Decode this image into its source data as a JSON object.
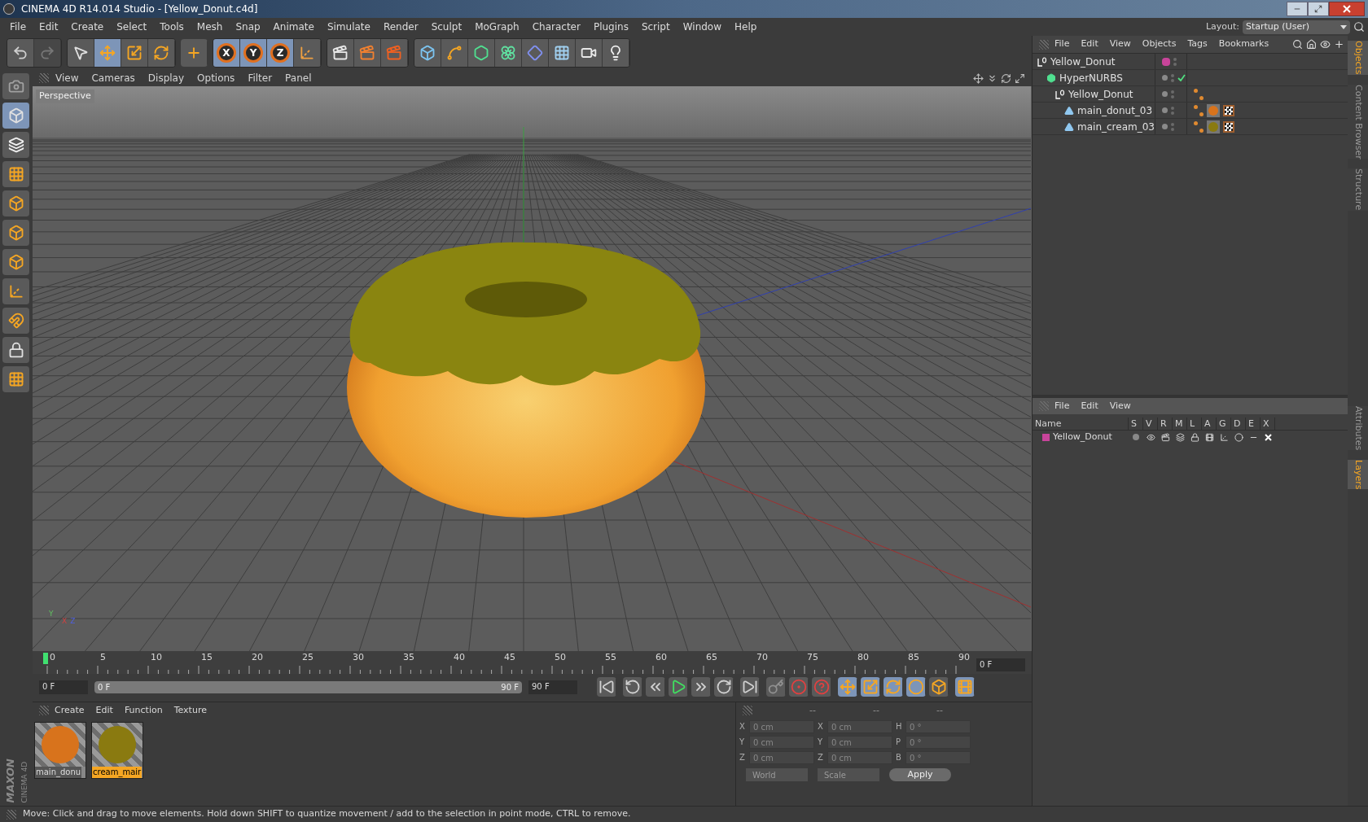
{
  "window": {
    "title": "CINEMA 4D R14.014 Studio - [Yellow_Donut.c4d]"
  },
  "menu_bar": [
    "File",
    "Edit",
    "Create",
    "Select",
    "Tools",
    "Mesh",
    "Snap",
    "Animate",
    "Simulate",
    "Render",
    "Sculpt",
    "MoGraph",
    "Character",
    "Plugins",
    "Script",
    "Window",
    "Help"
  ],
  "layout": {
    "label": "Layout:",
    "value": "Startup (User)"
  },
  "toolbar": [
    [
      {
        "kind": "undo",
        "selected": false,
        "disabled": false
      },
      {
        "kind": "redo",
        "selected": false,
        "disabled": true
      }
    ],
    [
      {
        "kind": "select",
        "selected": false,
        "disabled": false
      },
      {
        "kind": "move",
        "selected": true,
        "disabled": false
      },
      {
        "kind": "scale",
        "selected": false,
        "disabled": false
      },
      {
        "kind": "rotate",
        "selected": false,
        "disabled": false
      }
    ],
    [
      {
        "kind": "add",
        "selected": false,
        "disabled": false
      }
    ],
    [
      {
        "kind": "axis",
        "label": "X",
        "selected": true,
        "disabled": false
      },
      {
        "kind": "axis",
        "label": "Y",
        "selected": true,
        "disabled": false
      },
      {
        "kind": "axis",
        "label": "Z",
        "selected": true,
        "disabled": false
      },
      {
        "kind": "coords",
        "selected": false,
        "disabled": false
      }
    ],
    [
      {
        "kind": "render_view",
        "selected": false,
        "disabled": false
      },
      {
        "kind": "render_picture",
        "selected": false,
        "disabled": false
      },
      {
        "kind": "render_settings",
        "selected": false,
        "disabled": false
      }
    ],
    [
      {
        "kind": "cube",
        "selected": false,
        "disabled": false
      },
      {
        "kind": "spline",
        "selected": false,
        "disabled": false
      },
      {
        "kind": "nurbs",
        "selected": false,
        "disabled": false
      },
      {
        "kind": "array",
        "selected": false,
        "disabled": false
      },
      {
        "kind": "deformer",
        "selected": false,
        "disabled": false
      },
      {
        "kind": "floor",
        "selected": false,
        "disabled": false
      },
      {
        "kind": "camera",
        "selected": false,
        "disabled": false
      },
      {
        "kind": "light",
        "selected": false,
        "disabled": false
      }
    ]
  ],
  "left_tools": [
    {
      "kind": "view",
      "selected": false
    },
    {
      "kind": "model",
      "selected": true
    },
    {
      "kind": "texture",
      "selected": false
    },
    {
      "kind": "workplane",
      "selected": false
    },
    {
      "kind": "points",
      "selected": false
    },
    {
      "kind": "edges",
      "selected": false
    },
    {
      "kind": "polygons",
      "selected": false
    },
    {
      "kind": "axis",
      "selected": false
    },
    {
      "kind": "magnet",
      "selected": false
    },
    {
      "kind": "lock",
      "selected": false
    },
    {
      "kind": "grid",
      "selected": false
    }
  ],
  "brand": {
    "maker": "MAXON",
    "product": "CINEMA 4D"
  },
  "viewport": {
    "menu": [
      "View",
      "Cameras",
      "Display",
      "Options",
      "Filter",
      "Panel"
    ],
    "label": "Perspective",
    "axis_labels": [
      "Y",
      "X",
      "Z"
    ]
  },
  "objects_panel": {
    "menu": [
      "File",
      "Edit",
      "View",
      "Objects",
      "Tags",
      "Bookmarks"
    ],
    "tree": [
      {
        "name": "Yellow_Donut",
        "kind": "null",
        "color": "#c8449a",
        "check": false,
        "children": [
          {
            "name": "HyperNURBS",
            "kind": "nurbs",
            "check": true,
            "children": [
              {
                "name": "Yellow_Donut",
                "kind": "null",
                "check": false,
                "tags": [
                  {
                    "kind": "phong"
                  }
                ],
                "children": [
                  {
                    "name": "main_donut_03",
                    "kind": "polygon",
                    "check": false,
                    "tags": [
                      {
                        "kind": "phong"
                      },
                      {
                        "kind": "material",
                        "color": "#d8731c"
                      },
                      {
                        "kind": "texture"
                      }
                    ]
                  },
                  {
                    "name": "main_cream_03",
                    "kind": "polygon",
                    "check": false,
                    "tags": [
                      {
                        "kind": "phong"
                      },
                      {
                        "kind": "material",
                        "color": "#8a7a10"
                      },
                      {
                        "kind": "texture"
                      }
                    ]
                  }
                ]
              }
            ]
          }
        ]
      }
    ]
  },
  "layers_panel": {
    "menu": [
      "File",
      "Edit",
      "View"
    ],
    "columns": [
      "Name",
      "S",
      "V",
      "R",
      "M",
      "L",
      "A",
      "G",
      "D",
      "E",
      "X"
    ],
    "rows": [
      {
        "name": "Yellow_Donut",
        "color": "#c8449a"
      }
    ]
  },
  "side_tabs": [
    {
      "label": "Objects",
      "selected": true
    },
    {
      "label": "Content Browser",
      "selected": false
    },
    {
      "label": "Structure",
      "selected": false
    },
    {
      "label": "Attributes",
      "selected": false
    },
    {
      "label": "Layers",
      "selected": true
    }
  ],
  "timeline": {
    "ticks": [
      "0",
      "5",
      "10",
      "15",
      "20",
      "25",
      "30",
      "35",
      "40",
      "45",
      "50",
      "55",
      "60",
      "65",
      "70",
      "75",
      "80",
      "85",
      "90"
    ],
    "level": 0,
    "current": "0 F",
    "start": "0 F",
    "range": {
      "start": "0 F",
      "end": "90 F",
      "level": 1
    },
    "end": "90 F"
  },
  "transport": [
    {
      "kind": "first",
      "selected": false
    },
    {
      "kind": "prev_key",
      "selected": false
    },
    {
      "kind": "prev_frame",
      "selected": false
    },
    {
      "kind": "play",
      "selected": false
    },
    {
      "kind": "next_frame",
      "selected": false
    },
    {
      "kind": "next_key",
      "selected": false
    },
    {
      "kind": "last",
      "selected": false
    },
    {
      "kind": "autokey",
      "selected": false
    },
    {
      "kind": "record",
      "selected": false
    },
    {
      "kind": "help",
      "selected": false
    },
    {
      "kind": "pos",
      "selected": true
    },
    {
      "kind": "scale",
      "selected": true
    },
    {
      "kind": "rot",
      "selected": true
    },
    {
      "kind": "param",
      "selected": true
    },
    {
      "kind": "points",
      "selected": false
    },
    {
      "kind": "film",
      "selected": true
    }
  ],
  "materials": {
    "menu": [
      "Create",
      "Edit",
      "Function",
      "Texture"
    ],
    "items": [
      {
        "name": "main_donu",
        "color": "#d8731c",
        "selected": false
      },
      {
        "name": "cream_mair",
        "color": "#8a7a10",
        "selected": true
      }
    ]
  },
  "coordinates": {
    "headers": [
      "--",
      "--",
      "--"
    ],
    "rows": [
      [
        {
          "axis": "X",
          "value": "0 cm"
        },
        {
          "axis": "X",
          "value": "0 cm"
        },
        {
          "axis": "H",
          "value": "0 °"
        }
      ],
      [
        {
          "axis": "Y",
          "value": "0 cm"
        },
        {
          "axis": "Y",
          "value": "0 cm"
        },
        {
          "axis": "P",
          "value": "0 °"
        }
      ],
      [
        {
          "axis": "Z",
          "value": "0 cm"
        },
        {
          "axis": "Z",
          "value": "0 cm"
        },
        {
          "axis": "B",
          "value": "0 °"
        }
      ]
    ],
    "selects": [
      "World",
      "Scale"
    ],
    "apply": "Apply"
  },
  "status_bar": "Move: Click and drag to move elements. Hold down SHIFT to quantize movement / add to the selection in point mode, CTRL to remove."
}
